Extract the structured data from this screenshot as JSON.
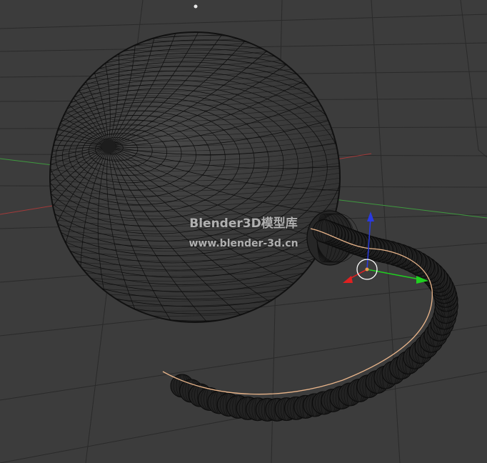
{
  "watermark": {
    "title": "Blender3D模型库",
    "url": "www.blender-3d.cn"
  },
  "colors": {
    "background": "#3c3c3c",
    "grid_line": "#2a2a2a",
    "x_axis": "#a33a3a",
    "y_axis": "#3f9a3f",
    "wire": "#0c0c0c",
    "curve": "#e8b48a",
    "gizmo_x": "#e02020",
    "gizmo_y": "#20d020",
    "gizmo_z": "#2a3ae0",
    "cursor": "#ffffff"
  },
  "scene": {
    "objects": [
      "bomb-sphere",
      "fuse-cap",
      "fuse-rope",
      "fuse-curve"
    ],
    "icons": [
      "3d-cursor-icon",
      "move-gizmo-icon",
      "origin-point-icon"
    ]
  }
}
